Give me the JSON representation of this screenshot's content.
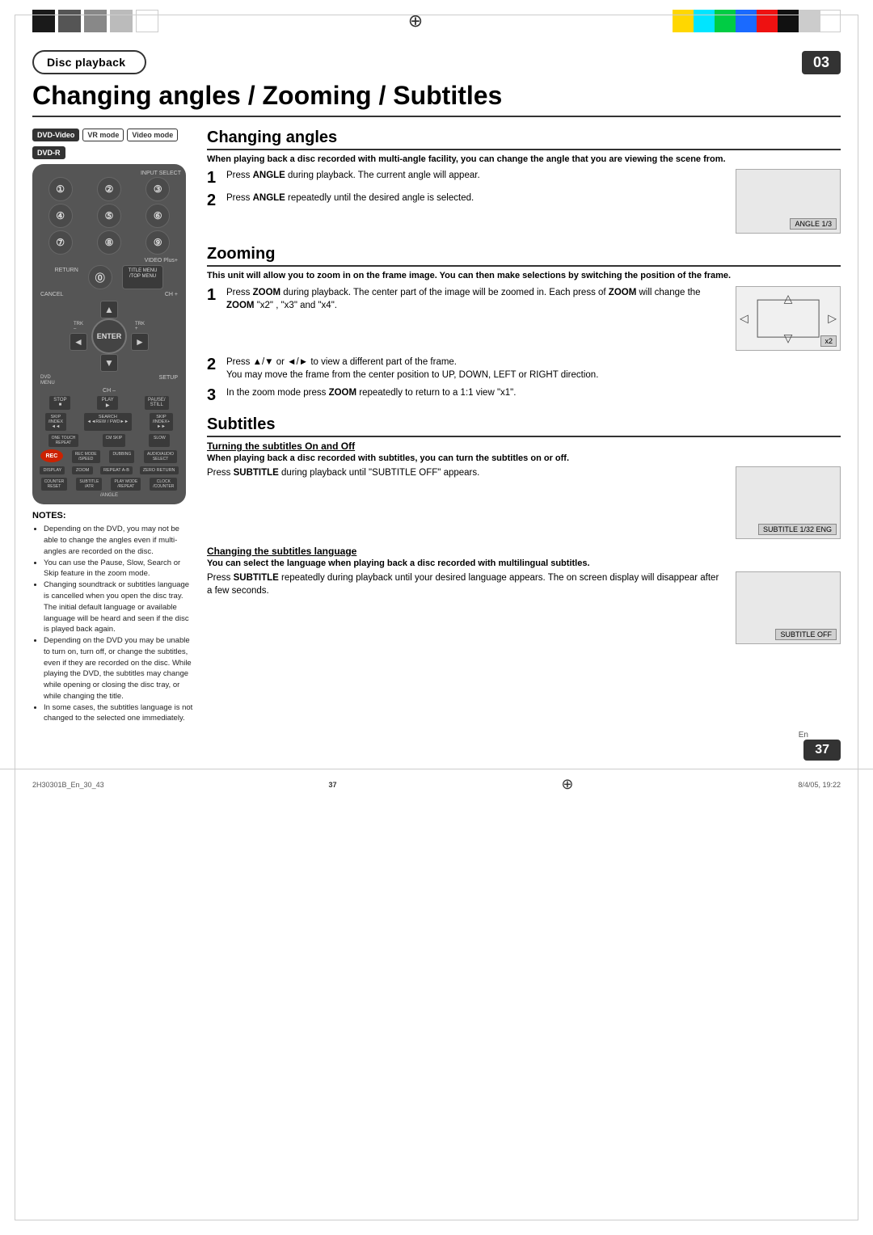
{
  "page": {
    "section": "Disc playback",
    "section_number": "03",
    "title": "Changing angles / Zooming / Subtitles",
    "page_number": "37",
    "footer_left": "2H30301B_En_30_43",
    "footer_center": "37",
    "footer_right": "8/4/05, 19:22",
    "en_label": "En"
  },
  "badges": {
    "dvd_video": "DVD-Video",
    "vr_mode": "VR mode",
    "video_mode": "Video mode",
    "dvd_r": "DVD-R"
  },
  "changing_angles": {
    "title": "Changing angles",
    "intro": "When playing back a disc recorded with multi-angle facility, you can change the angle that you are viewing the scene from.",
    "step1_text": "Press ANGLE during playback. The current angle will appear.",
    "step1_bold": "ANGLE",
    "step2_text": "Press ANGLE repeatedly until the desired angle is selected.",
    "step2_bold": "ANGLE",
    "screen_label": "ANGLE  1/3"
  },
  "zooming": {
    "title": "Zooming",
    "intro": "This unit will allow you to zoom in on the frame image. You can then make selections by switching the position of the frame.",
    "step1_text": "Press ZOOM during playback. The center part of the image will be zoomed in. Each press of ZOOM will change the ZOOM \"x2\" , \"x3\" and \"x4\".",
    "step1_bold1": "ZOOM",
    "step1_bold2": "ZOOM",
    "step1_bold3": "ZOOM",
    "step2_text": "Press ▲/▼ or ◄/► to view a different part of the frame. You may move the frame from the center position to UP, DOWN, LEFT or RIGHT direction.",
    "step3_text": "In the zoom mode press ZOOM repeatedly to return to a 1:1 view \"x1\".",
    "step3_bold": "ZOOM",
    "zoom_x2_label": "x2"
  },
  "subtitles": {
    "title": "Subtitles",
    "turning_title": "Turning the subtitles On and Off",
    "turning_intro": "When playing back a disc recorded with subtitles, you can turn the subtitles on or off.",
    "turning_text": "Press SUBTITLE during playback until \"SUBTITLE OFF\" appears.",
    "turning_bold": "SUBTITLE",
    "turning_screen_label": "SUBTITLE 1/32 ENG",
    "changing_title": "Changing the subtitles language",
    "changing_intro": "You can select the language when playing back a disc recorded with multilingual subtitles.",
    "changing_text": "Press SUBTITLE repeatedly during playback until your desired language appears. The on screen display will disappear after a few seconds.",
    "changing_bold": "SUBTITLE",
    "changing_screen_label": "SUBTITLE OFF"
  },
  "notes": {
    "title": "NOTES:",
    "items": [
      "Depending on the DVD, you may not be able to change the angles even if multi-angles are recorded on the disc.",
      "You can use the Pause, Slow, Search or Skip feature in the zoom mode.",
      "Changing soundtrack or subtitles language is cancelled when you open the disc tray. The initial default language or available language will be heard and seen if the disc is played back again.",
      "Depending on the DVD you may be unable to turn on, turn off, or change the subtitles, even if they are recorded on the disc. While playing the DVD, the subtitles may change while opening or closing the disc tray, or while changing the title.",
      "In some cases, the subtitles language is not changed to the selected one immediately."
    ]
  },
  "remote": {
    "cancel_label": "CANCEL",
    "ch_plus": "CH +",
    "ch_minus": "CH –",
    "enter": "ENTER",
    "trk_minus": "TRK\n–",
    "trk_plus": "TRK\n+",
    "dvd_menu": "DVD\nMENU",
    "setup": "SETUP",
    "stop": "STOP",
    "play": "PLAY",
    "pause_still": "PAUSE/STILL",
    "rec": "REC",
    "display": "DISPLAY",
    "zoom": "ZOOM",
    "subtitle": "SUBTITLE",
    "return": "RETURN",
    "title_menu": "TITLE MENU\n/ TOP MENU"
  },
  "colors": {
    "accent": "#333333",
    "badge_bg": "#333333",
    "page_num_bg": "#333333",
    "remote_bg": "#555555"
  }
}
